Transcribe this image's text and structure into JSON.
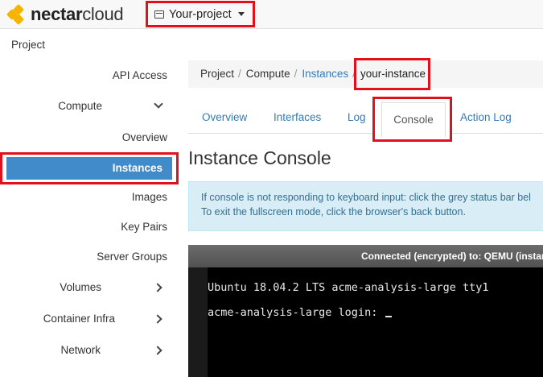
{
  "brand": {
    "name_bold": "nectar",
    "name_light": "cloud"
  },
  "project_picker": {
    "label": "Your-project"
  },
  "sidebar": {
    "section": "Project",
    "items": [
      {
        "label": "API Access"
      },
      {
        "label": "Compute"
      },
      {
        "label": "Overview"
      },
      {
        "label": "Instances"
      },
      {
        "label": "Images"
      },
      {
        "label": "Key Pairs"
      },
      {
        "label": "Server Groups"
      },
      {
        "label": "Volumes"
      },
      {
        "label": "Container Infra"
      },
      {
        "label": "Network"
      }
    ]
  },
  "breadcrumb": {
    "items": [
      "Project",
      "Compute",
      "Instances"
    ],
    "current": "your-instance"
  },
  "tabs": [
    "Overview",
    "Interfaces",
    "Log",
    "Console",
    "Action Log"
  ],
  "page_title": "Instance Console",
  "alert": {
    "line1": "If console is not responding to keyboard input: click the grey status bar bel",
    "line2": "To exit the fullscreen mode, click the browser's back button."
  },
  "console": {
    "status": "Connected (encrypted) to: QEMU (instar",
    "line1": "Ubuntu 18.04.2 LTS acme-analysis-large tty1",
    "line2": "acme-analysis-large login: "
  },
  "colors": {
    "accent": "#428bca",
    "link": "#337ab7",
    "highlight": "#e3101b",
    "alert_bg": "#d9edf7",
    "logo": "#f5b400"
  }
}
